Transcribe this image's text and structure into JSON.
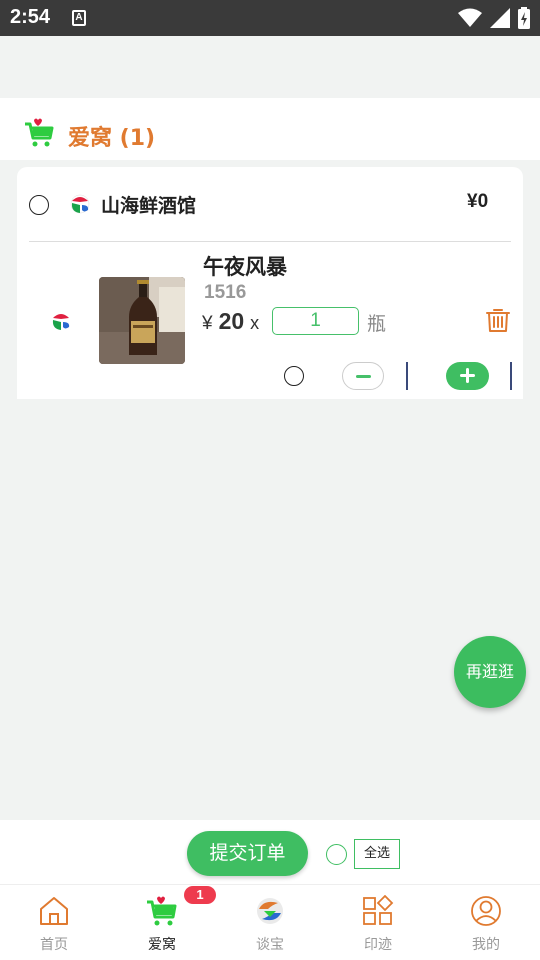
{
  "status_bar": {
    "time": "2:54",
    "notification_glyph": "A",
    "icons": [
      "wifi-icon",
      "signal-icon",
      "battery-charging-icon"
    ]
  },
  "header": {
    "title": "爱窝 (1)",
    "icon": "cart-icon"
  },
  "shop": {
    "name": "山海鲜酒馆",
    "total": "¥0",
    "selected": false,
    "items": [
      {
        "name": "午夜风暴",
        "code": "1516",
        "currency": "¥",
        "price": "20",
        "times": "x",
        "quantity": "1",
        "unit": "瓶",
        "selected": false
      }
    ]
  },
  "fab": {
    "label": "再逛逛"
  },
  "footer": {
    "submit_label": "提交订单",
    "select_all_label": "全选"
  },
  "tabs": [
    {
      "label": "首页",
      "icon": "home-icon",
      "active": false
    },
    {
      "label": "爱窝",
      "icon": "cart-icon",
      "active": true,
      "badge": "1"
    },
    {
      "label": "谈宝",
      "icon": "talk-logo-icon",
      "active": false
    },
    {
      "label": "印迹",
      "icon": "grid-icon",
      "active": false
    },
    {
      "label": "我的",
      "icon": "profile-icon",
      "active": false
    }
  ],
  "colors": {
    "accent_green": "#3fbe62",
    "header_orange": "#e07a30",
    "badge_red": "#ee3b4e"
  }
}
